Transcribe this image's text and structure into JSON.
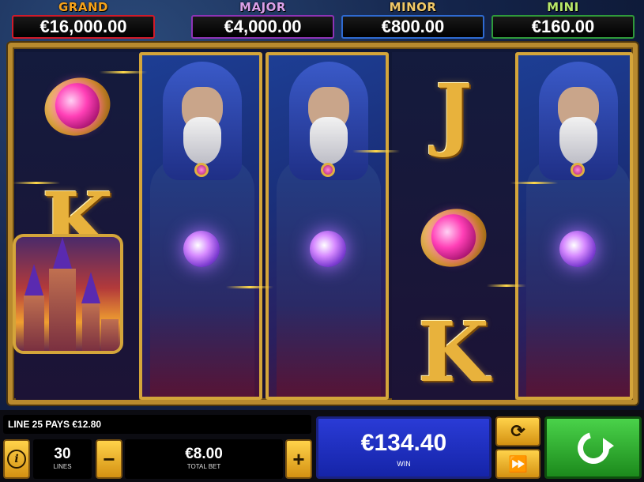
{
  "jackpots": {
    "grand": {
      "label": "GRAND",
      "value": "€16,000.00"
    },
    "major": {
      "label": "MAJOR",
      "value": "€4,000.00"
    },
    "minor": {
      "label": "MINOR",
      "value": "€800.00"
    },
    "mini": {
      "label": "MINI",
      "value": "€160.00"
    }
  },
  "reels": {
    "reel1": {
      "symbols": [
        "ring-icon",
        "K",
        "castle-icon"
      ]
    },
    "reel2": {
      "symbol": "wizard-icon"
    },
    "reel3": {
      "symbol": "wizard-icon"
    },
    "reel4": {
      "symbols": [
        "J",
        "ring-icon",
        "K"
      ]
    },
    "reel5": {
      "symbol": "wizard-icon"
    },
    "letter_j": "J",
    "letter_k": "K"
  },
  "status": {
    "line_pays": "LINE 25 PAYS €12.80"
  },
  "controls": {
    "lines_value": "30",
    "lines_label": "LINES",
    "total_bet_value": "€8.00",
    "total_bet_label": "TOTAL BET",
    "win_value": "€134.40",
    "win_label": "WIN",
    "minus_label": "−",
    "plus_label": "+",
    "info_label": "i",
    "autoplay_icon": "⟳",
    "turbo_icon": "⏩"
  },
  "colors": {
    "frame_gold": "#d4a53a",
    "win_blue": "#2a3bd6",
    "spin_green": "#1c8a1c"
  }
}
